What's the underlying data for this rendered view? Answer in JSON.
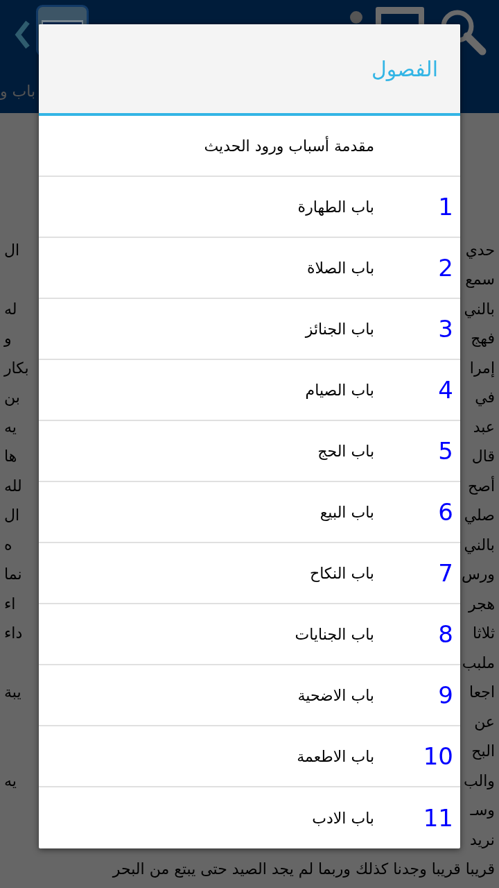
{
  "app_bar": {
    "subtitle": "باب و"
  },
  "background_text": [
    {
      "right": "حدي",
      "left": "ال"
    },
    {
      "right": "سمع"
    },
    {
      "right": "بالني",
      "left": "له"
    },
    {
      "right": "فهج",
      "left": "و"
    },
    {
      "right": "إمرا",
      "left": "بكار"
    },
    {
      "right": "في",
      "left": "بن"
    },
    {
      "right": "عبد",
      "left": "يه"
    },
    {
      "right": "قال",
      "left": "ها"
    },
    {
      "right": "أصح",
      "left": "لله"
    },
    {
      "right": "صلي",
      "left": "ال"
    },
    {
      "right": "بالني",
      "left": "ه"
    },
    {
      "right": "ورس",
      "left": "نما"
    },
    {
      "right": "هجر",
      "left": "اء"
    },
    {
      "right": "ثلاثا",
      "left": "داء"
    },
    {
      "right": "ملبب"
    },
    {
      "right": "اجعا",
      "left": "يبة"
    },
    {
      "right": "عن"
    },
    {
      "right": "البح"
    },
    {
      "right": "والب",
      "left": "يه"
    },
    {
      "right": "وسـ"
    },
    {
      "right": "نريد"
    },
    {
      "right": "قريبا قريبا وجدنا كذلك وربما لم يجد الصيد حتى يبتع من البحر"
    }
  ],
  "dialog": {
    "title": "الفصول",
    "items": [
      {
        "label": "مقدمة أسباب ورود الحديث"
      },
      {
        "number": "1",
        "label": "باب الطهارة"
      },
      {
        "number": "2",
        "label": "باب الصلاة"
      },
      {
        "number": "3",
        "label": "باب الجنائز"
      },
      {
        "number": "4",
        "label": "باب الصيام"
      },
      {
        "number": "5",
        "label": "باب الحج"
      },
      {
        "number": "6",
        "label": "باب البيع"
      },
      {
        "number": "7",
        "label": "باب النكاح"
      },
      {
        "number": "8",
        "label": "باب الجنايات"
      },
      {
        "number": "9",
        "label": "باب الاضحية"
      },
      {
        "number": "10",
        "label": "باب الاطعمة"
      },
      {
        "number": "11",
        "label": "باب الادب"
      }
    ]
  }
}
